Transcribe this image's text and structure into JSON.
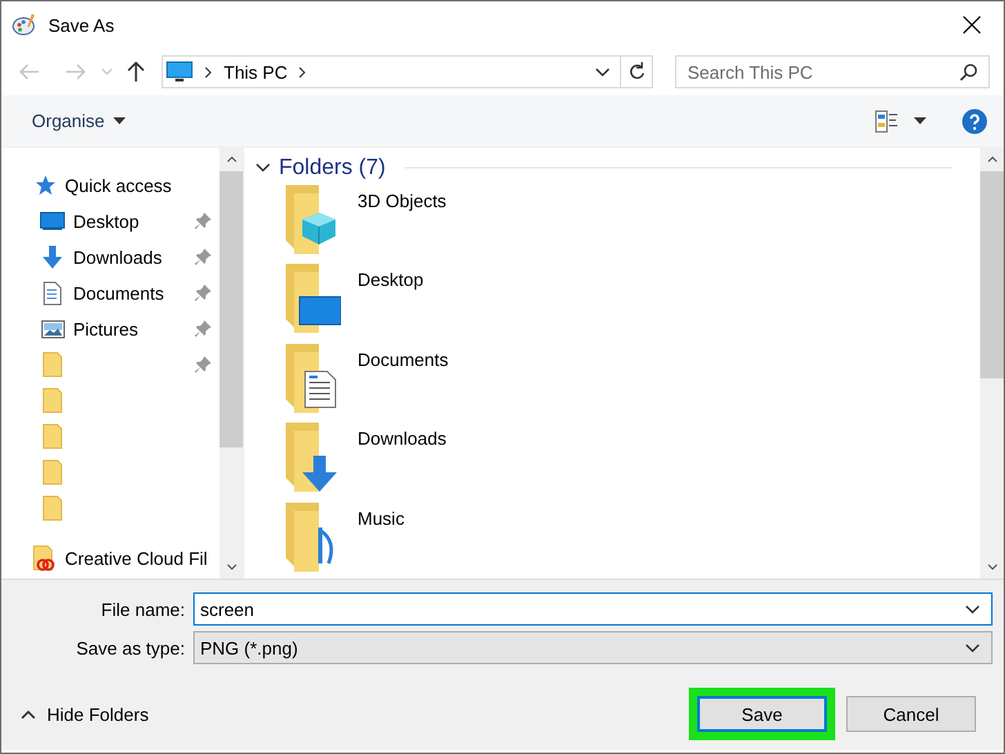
{
  "window": {
    "title": "Save As"
  },
  "address": {
    "path": "This PC",
    "search_placeholder": "Search This PC"
  },
  "toolbar": {
    "organise": "Organise"
  },
  "navigation": {
    "root": {
      "label": "Quick access",
      "kind": "star",
      "children": [
        {
          "label": "Desktop",
          "kind": "desktop",
          "pinned": true
        },
        {
          "label": "Downloads",
          "kind": "downloads",
          "pinned": true
        },
        {
          "label": "Documents",
          "kind": "documents",
          "pinned": true
        },
        {
          "label": "Pictures",
          "kind": "pictures",
          "pinned": true
        },
        {
          "kind": "folder",
          "pinned": true
        },
        {
          "kind": "folder",
          "pinned": false
        },
        {
          "kind": "folder",
          "pinned": false
        },
        {
          "kind": "folder",
          "pinned": false
        },
        {
          "kind": "folder",
          "pinned": false
        }
      ]
    },
    "items": [
      {
        "label": "Creative Cloud Fil",
        "kind": "creative-cloud"
      }
    ]
  },
  "folders": {
    "heading": "Folders (7)",
    "expanded": true,
    "items": [
      {
        "label": "3D Objects",
        "kind": "objects3d"
      },
      {
        "label": "Desktop",
        "kind": "desktop"
      },
      {
        "label": "Documents",
        "kind": "documents"
      },
      {
        "label": "Downloads",
        "kind": "downloads"
      },
      {
        "label": "Music",
        "kind": "music"
      }
    ]
  },
  "file_name": {
    "label": "File name:",
    "value": "screen"
  },
  "save_type": {
    "label": "Save as type:",
    "value": "PNG (*.png)"
  },
  "hide_folders": "Hide Folders",
  "buttons": [
    {
      "label": "Save",
      "highlighted": true
    },
    {
      "label": "Cancel",
      "highlighted": false
    }
  ]
}
